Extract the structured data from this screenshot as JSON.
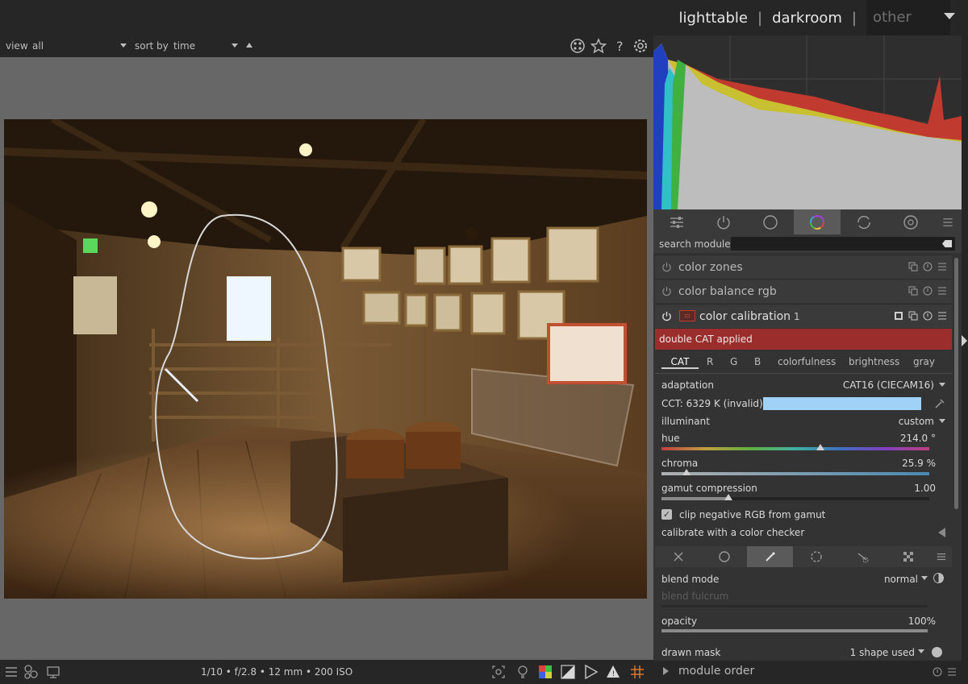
{
  "header": {
    "views": [
      "lighttable",
      "darkroom"
    ],
    "other_label": "other"
  },
  "filterbar": {
    "view_label": "view",
    "view_value": "all",
    "sort_label": "sort by",
    "sort_value": "time",
    "icons": [
      "presets-icon",
      "star-icon",
      "help-icon",
      "gear-icon"
    ]
  },
  "bottombar": {
    "image_info": "1/10 • f/2.8 • 12 mm • 200 ISO",
    "left_icons": [
      "menu-icon",
      "styles-icon",
      "display-icon"
    ],
    "right_icons": [
      "focus-peaking-icon",
      "lightbulb-icon",
      "color-assessment-icon",
      "overexposure-icon",
      "softproof-icon",
      "gamut-check-icon",
      "guides-icon"
    ]
  },
  "module_groups": {
    "icons": [
      "sliders-icon",
      "power-icon",
      "circle-icon",
      "color-wheel-icon",
      "correct-icon",
      "effects-icon"
    ],
    "active_index": 3
  },
  "search": {
    "label": "search module",
    "placeholder": ""
  },
  "modules": [
    {
      "name": "color zones"
    },
    {
      "name": "color balance rgb"
    }
  ],
  "color_calibration": {
    "name": "color calibration",
    "instance": "1",
    "warning": "double CAT applied",
    "tabs": [
      "CAT",
      "R",
      "G",
      "B",
      "colorfulness",
      "brightness",
      "gray"
    ],
    "adaptation_label": "adaptation",
    "adaptation_value": "CAT16 (CIECAM16)",
    "cct_text": "CCT: 6329 K (invalid)",
    "cct_swatch_color": "#9fd2f6",
    "illuminant_label": "illuminant",
    "illuminant_value": "custom",
    "hue_label": "hue",
    "hue_value": "214.0 °",
    "hue_fraction": 0.594,
    "chroma_label": "chroma",
    "chroma_value": "25.9 %",
    "chroma_fraction": 0.092,
    "gamut_label": "gamut compression",
    "gamut_value": "1.00",
    "gamut_fraction": 0.25,
    "clip_label": "clip negative RGB from gamut",
    "clip_checked": true,
    "checker_label": "calibrate with a color checker"
  },
  "blending": {
    "tab_icons": [
      "off-icon",
      "uniform-icon",
      "drawn-mask-icon",
      "parametric-icon",
      "drawn-parametric-icon",
      "raster-icon"
    ],
    "active_index": 2,
    "blend_mode_label": "blend mode",
    "blend_mode_value": "normal",
    "fulcrum_label": "blend fulcrum",
    "opacity_label": "opacity",
    "opacity_value": "100%",
    "opacity_fraction": 1.0,
    "drawn_mask_label": "drawn mask",
    "drawn_mask_value": "1 shape used"
  },
  "module_order": {
    "label": "module order"
  },
  "colors": {
    "warning_red": "#9b2d2c",
    "active_tab": "#5a5a5a",
    "panel_bg": "#333333"
  }
}
